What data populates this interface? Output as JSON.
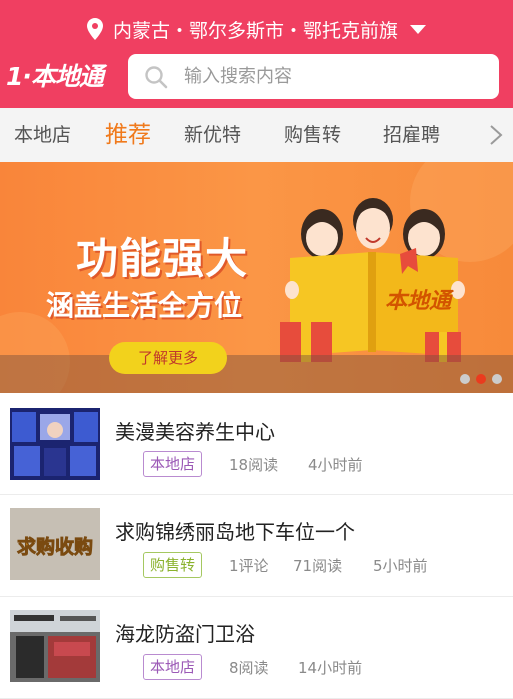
{
  "header": {
    "location": "内蒙古・鄂尔多斯市・鄂托克前旗",
    "logo": "1·本地通",
    "search_placeholder": "输入搜索内容"
  },
  "tabs": [
    {
      "label": "本地店",
      "active": false
    },
    {
      "label": "推荐",
      "active": true
    },
    {
      "label": "新优特",
      "active": false
    },
    {
      "label": "购售转",
      "active": false
    },
    {
      "label": "招雇聘",
      "active": false
    }
  ],
  "banner": {
    "title": "功能强大",
    "subtitle": "涵盖生活全方位",
    "button": "了解更多",
    "book_text": "本地通",
    "active_slide": 2,
    "slides": 3
  },
  "feed": [
    {
      "title": "美漫美容养生中心",
      "tag": "本地店",
      "tag_color": "#9b59b6",
      "comments": "",
      "reads": "18阅读",
      "time": "4小时前"
    },
    {
      "title": "求购锦绣丽岛地下车位一个",
      "tag": "购售转",
      "tag_color": "#8bb22e",
      "comments": "1评论",
      "reads": "71阅读",
      "time": "5小时前",
      "thumb_text": "求购收购"
    },
    {
      "title": "海龙防盗门卫浴",
      "tag": "本地店",
      "tag_color": "#9b59b6",
      "comments": "",
      "reads": "8阅读",
      "time": "14小时前"
    }
  ],
  "colors": {
    "brand": "#f03f61",
    "active_tab": "#f07a1c",
    "banner": "#fb9646"
  }
}
